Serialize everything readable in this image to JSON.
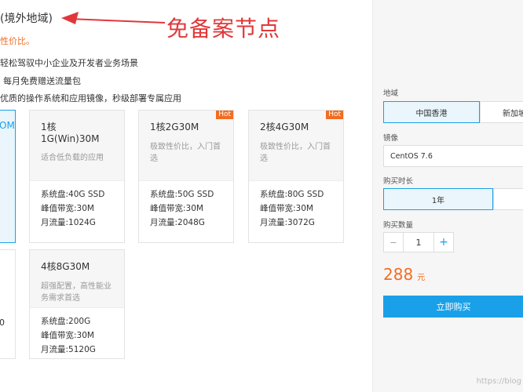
{
  "header": {
    "title": "(境外地域)",
    "annotation": "免备案节点",
    "subtitle": "性价比。",
    "features": [
      "轻松驾驭中小企业及开发者业务场景",
      "每月免费赠送流量包",
      "优质的操作系统和应用镜像，秒级部署专属应用"
    ]
  },
  "edge": {
    "selected_fragment": "OM",
    "bottom_fragment": "0"
  },
  "plans": [
    {
      "name": "1核1G(Win)30M",
      "desc": "适合低负载的应用",
      "hot": "",
      "disk": "系统盘:40G SSD",
      "bandwidth": "峰值带宽:30M",
      "traffic": "月流量:1024G"
    },
    {
      "name": "1核2G30M",
      "desc": "极致性价比，入门首选",
      "hot": "Hot",
      "disk": "系统盘:50G SSD",
      "bandwidth": "峰值带宽:30M",
      "traffic": "月流量:2048G"
    },
    {
      "name": "2核4G30M",
      "desc": "极致性价比，入门首选",
      "hot": "Hot",
      "disk": "系统盘:80G SSD",
      "bandwidth": "峰值带宽:30M",
      "traffic": "月流量:3072G"
    },
    {
      "name": "4核8G30M",
      "desc": "超强配置，高性能业务需求首选",
      "hot": "",
      "disk": "系统盘:200G",
      "bandwidth": "峰值带宽:30M",
      "traffic": "月流量:5120G"
    }
  ],
  "panel": {
    "region_label": "地域",
    "regions": [
      "中国香港",
      "新加坡"
    ],
    "image_label": "镜像",
    "image_value": "CentOS 7.6",
    "duration_label": "购买时长",
    "duration_value": "1年",
    "qty_label": "购买数量",
    "qty_minus": "−",
    "qty_value": "1",
    "qty_plus": "+",
    "price": "288",
    "price_unit": "元",
    "buy_label": "立即购买"
  },
  "watermark": "https://blog",
  "colors": {
    "accent": "#1aa0e8",
    "orange": "#f26d21",
    "annotation": "#e0383a"
  }
}
